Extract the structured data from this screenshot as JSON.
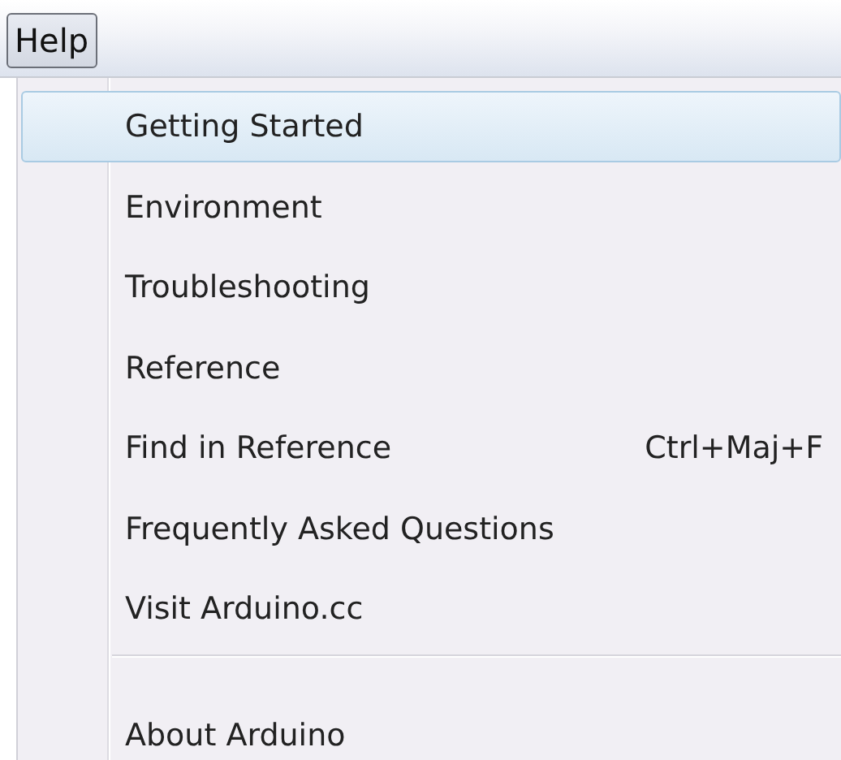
{
  "menu_bar": [
    {
      "label": "Help",
      "selected": true
    }
  ],
  "menu": {
    "items": [
      {
        "kind": "item",
        "label": "Getting Started",
        "selected": true
      },
      {
        "kind": "item",
        "label": "Environment",
        "selected": false
      },
      {
        "kind": "item",
        "label": "Troubleshooting",
        "selected": false
      },
      {
        "kind": "item",
        "label": "Reference",
        "selected": false
      },
      {
        "kind": "item",
        "label": "Find in Reference",
        "shortcut": "Ctrl+Maj+F",
        "selected": false
      },
      {
        "kind": "item",
        "label": "Frequently Asked Questions",
        "selected": false
      },
      {
        "kind": "item",
        "label": "Visit Arduino.cc",
        "selected": false
      },
      {
        "kind": "separator"
      },
      {
        "kind": "item",
        "label": "About Arduino",
        "selected": false
      }
    ]
  }
}
